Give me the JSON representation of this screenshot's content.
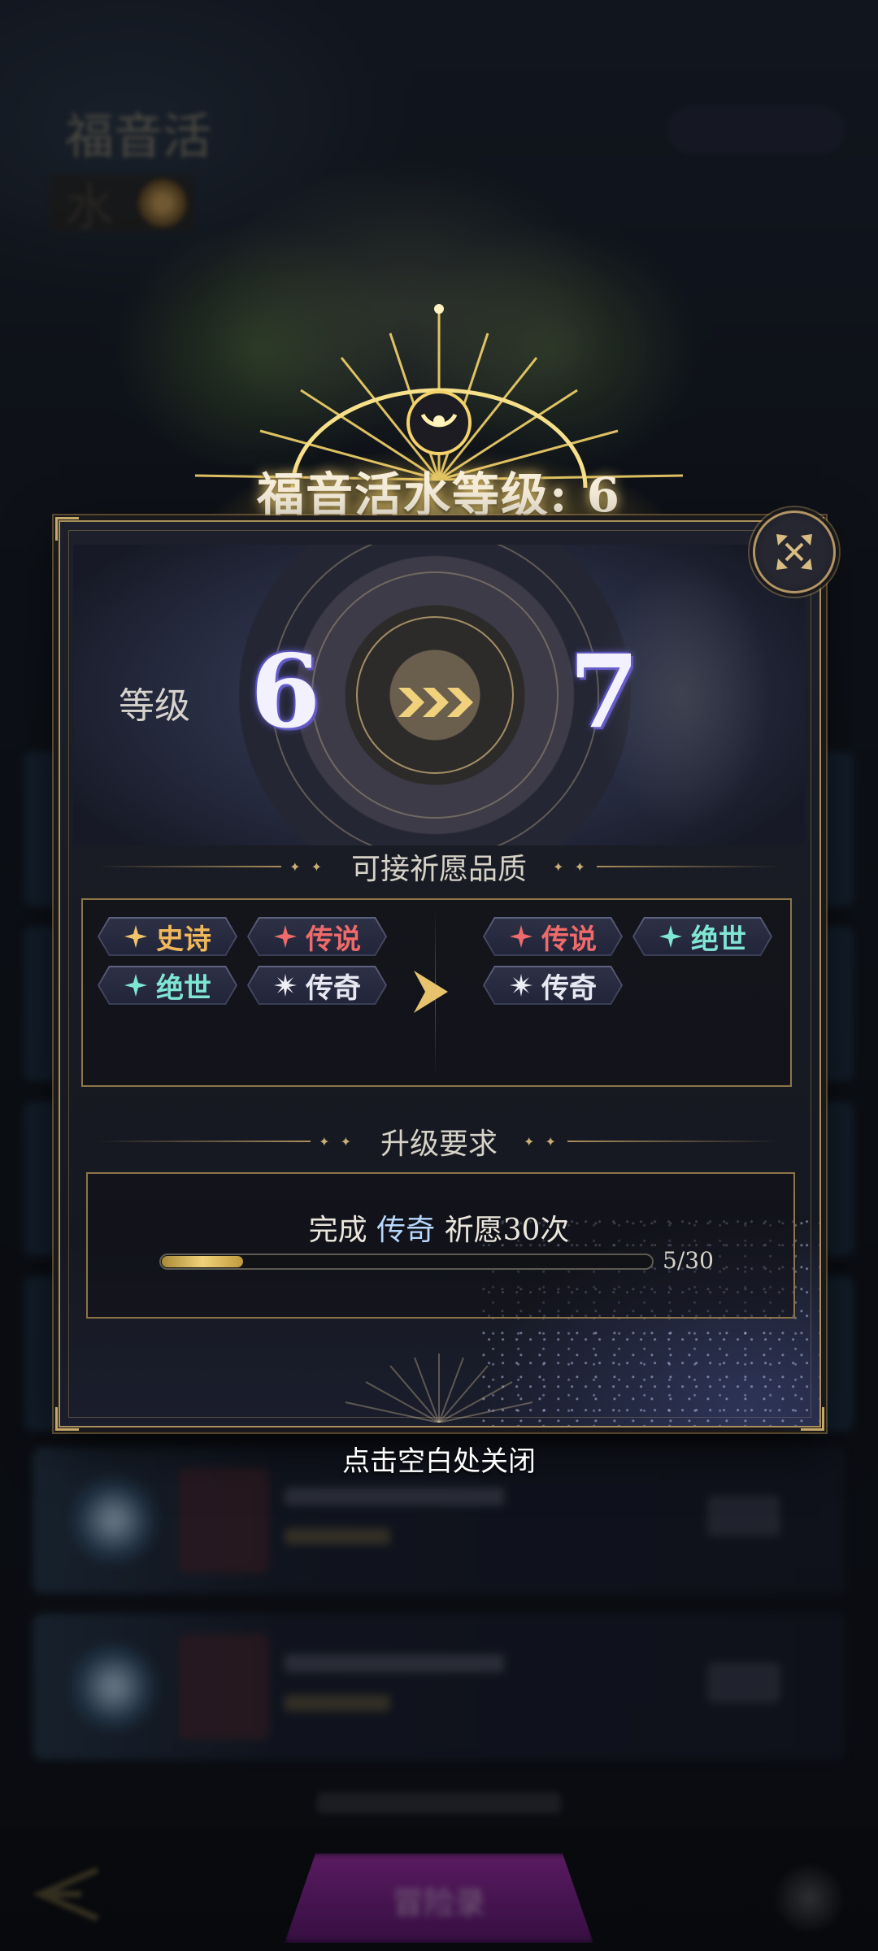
{
  "background": {
    "top_left_title": "福音活水",
    "bottom_button_label": "冒险录"
  },
  "modal": {
    "title": "福音活水等级: 6",
    "level": {
      "label": "等级",
      "from": "6",
      "to": "7"
    },
    "quality_section": {
      "title": "可接祈愿品质",
      "current": [
        {
          "label": "史诗",
          "tier": "epic",
          "color": "#f0b85a"
        },
        {
          "label": "传说",
          "tier": "legend",
          "color": "#ef6a6a"
        },
        {
          "label": "绝世",
          "tier": "peerless",
          "color": "#7fe6d4"
        },
        {
          "label": "传奇",
          "tier": "mythic",
          "color": "#e8e8f2"
        }
      ],
      "next": [
        {
          "label": "传说",
          "tier": "legend",
          "color": "#ef6a6a"
        },
        {
          "label": "绝世",
          "tier": "peerless",
          "color": "#7fe6d4"
        },
        {
          "label": "传奇",
          "tier": "mythic",
          "color": "#e8e8f2"
        }
      ]
    },
    "requirement_section": {
      "title": "升级要求",
      "text_prefix": "完成",
      "text_highlight": "传奇",
      "text_suffix": "祈愿30次",
      "progress_current": 5,
      "progress_total": 30,
      "progress_fraction": 0.1667,
      "progress_text": "5/30"
    },
    "close_hint": "点击空白处关闭"
  },
  "colors": {
    "gold_accent": "#a88e5c",
    "progress_gold": "#f0d27a",
    "level_purple": "#5c52b8"
  },
  "icons": {
    "close": "diagonal-arrows-icon",
    "level_arrow": "triple-chevron-right-icon",
    "quality_arrow": "arrow-right-icon",
    "tag_star": "four-point-star-icon"
  }
}
